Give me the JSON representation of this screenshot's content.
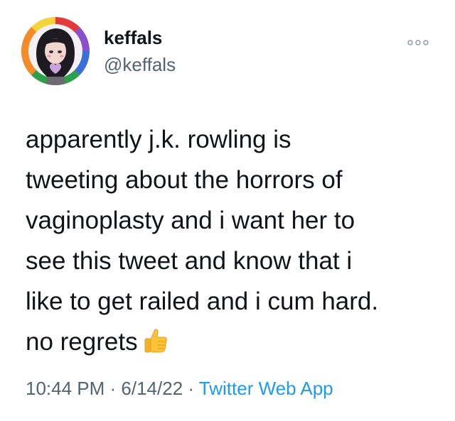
{
  "tweet": {
    "author": {
      "display_name": "keffals",
      "handle": "@keffals",
      "avatar": "rainbow-ring-illustrated-avatar"
    },
    "more_icon": "ellipsis-icon",
    "text": "apparently j.k. rowling is\ntweeting about the horrors of\nvaginoplasty and i want her to\nsee this tweet and know that i\nlike to get railed and i cum hard.\nno regrets",
    "emoji": "thumbs-up-icon",
    "time": "10:44 PM",
    "separator": " · ",
    "date": "6/14/22",
    "source": "Twitter Web App"
  },
  "colors": {
    "text_primary": "#0f1419",
    "text_secondary": "#536471",
    "link": "#1d9bf0",
    "background": "#ffffff"
  }
}
